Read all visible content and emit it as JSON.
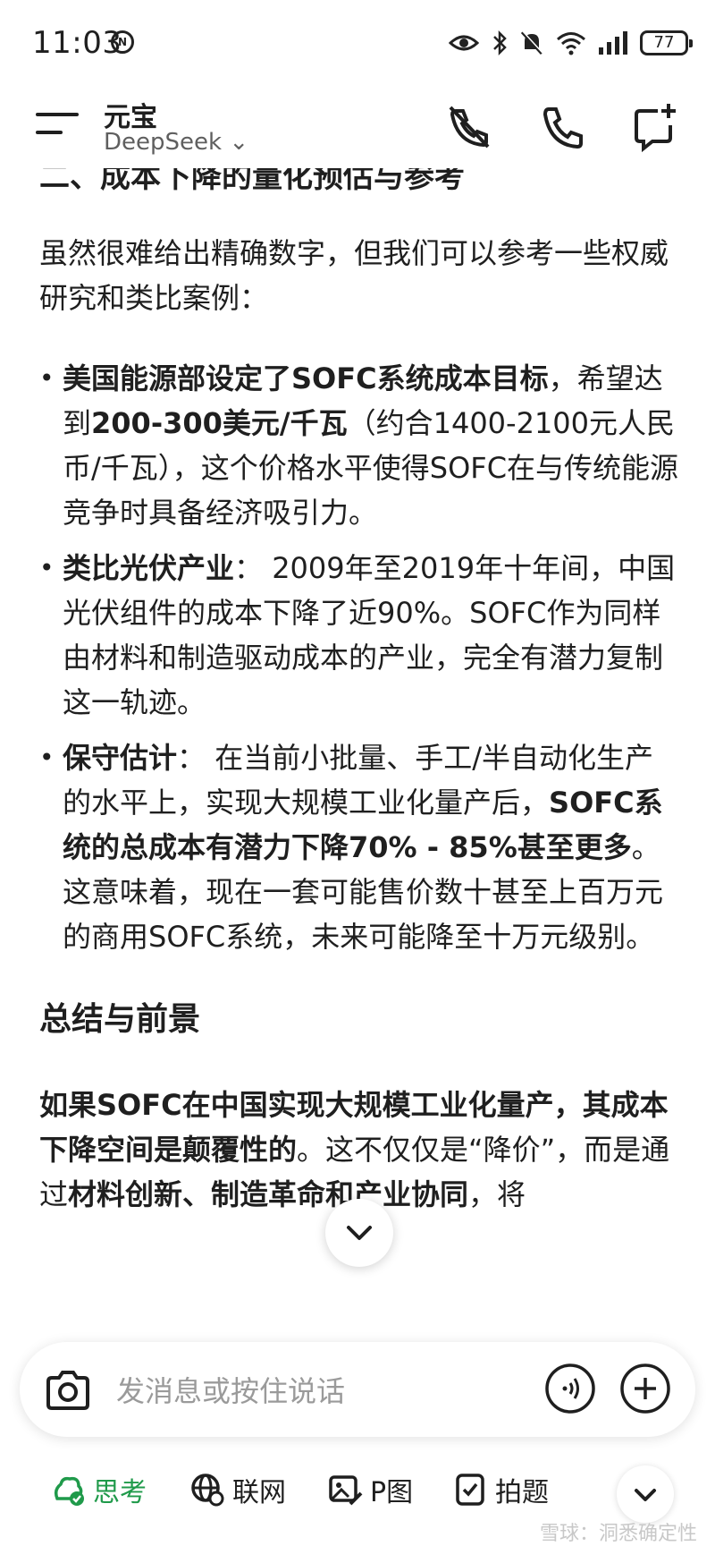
{
  "status_bar": {
    "time": "11:03",
    "time_badge": "N",
    "battery": "77"
  },
  "header": {
    "app_title": "元宝",
    "model": "DeepSeek ⌄"
  },
  "content": {
    "cut_heading": "二、成本下降的量化预估与参考",
    "intro": "虽然很难给出精确数字，但我们可以参考一些权威研究和类比案例：",
    "bullets": [
      {
        "bold1": "美国能源部设定了SOFC系统成本目标",
        "t1": "，希望达到",
        "bold2": "200-300美元/千瓦",
        "t2": "（约合1400-2100元人民币/千瓦），这个价格水平使得SOFC在与传统能源竞争时具备经济吸引力。"
      },
      {
        "bold1": "类比光伏产业",
        "t1": "： 2009年至2019年十年间，中国光伏组件的成本下降了近90%。SOFC作为同样由材料和制造驱动成本的产业，完全有潜力复制这一轨迹。"
      },
      {
        "bold1": "保守估计",
        "t1": "： 在当前小批量、手工/半自动化生产的水平上，实现大规模工业化量产后，",
        "bold2": "SOFC系统的总成本有潜力下降70% - 85%甚至更多",
        "t2": "。这意味着，现在一套可能售价数十甚至上百万元的商用SOFC系统，未来可能降至十万元级别。"
      }
    ],
    "section_title": "总结与前景",
    "summary": {
      "bold1": "如果SOFC在中国实现大规模工业化量产，其成本下降空间是颠覆性的",
      "t1": "。这不仅仅是“降价”，而是通过",
      "bold2": "材料创新、制造革命和产业协同",
      "t2": "，将"
    }
  },
  "input": {
    "placeholder": "发消息或按住说话"
  },
  "toolbar": {
    "think": "思考",
    "web": "联网",
    "image": "P图",
    "photo": "拍题"
  },
  "watermark": "雪球：洞悉确定性",
  "colors": {
    "accent_green": "#1f9a4a",
    "text": "#1f1f1f",
    "placeholder": "#9a9a9a"
  },
  "icons": [
    "eye-icon",
    "bluetooth-icon",
    "mute-bell-icon",
    "wifi-icon",
    "signal-icon",
    "battery-icon",
    "menu-icon",
    "phone-muted-icon",
    "phone-icon",
    "new-chat-icon",
    "chevron-down-icon",
    "camera-icon",
    "voice-icon",
    "plus-icon",
    "think-icon",
    "globe-icon",
    "image-edit-icon",
    "photo-question-icon"
  ]
}
